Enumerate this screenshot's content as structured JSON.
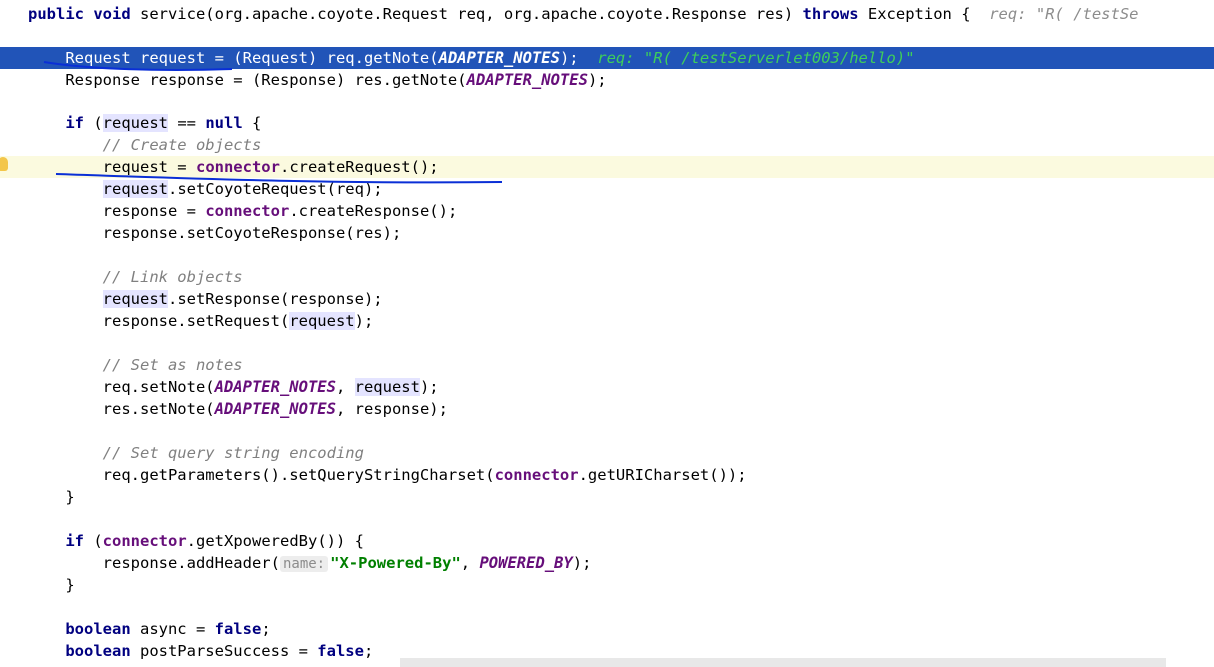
{
  "editor": {
    "lines": [
      {
        "id": "l0",
        "segs": [
          [
            "kw",
            "public void "
          ],
          [
            "",
            "service(org.apache.coyote.Request req, org.apache.coyote.Response res) "
          ],
          [
            "kw",
            "throws "
          ],
          [
            "",
            "Exception {  "
          ],
          [
            "inline-val",
            "req: \"R( /testSe"
          ]
        ]
      },
      {
        "id": "l1",
        "segs": []
      },
      {
        "id": "l2",
        "cls": "exec",
        "segs": [
          [
            "",
            "    Request request = (Request) req.getNote("
          ],
          [
            "const",
            "ADAPTER_NOTES"
          ],
          [
            "",
            ");  "
          ],
          [
            "inline-val",
            "req: \"R( /testServerlet003/hello)\""
          ]
        ]
      },
      {
        "id": "l3",
        "segs": [
          [
            "",
            "    Response response = (Response) res.getNote("
          ],
          [
            "const",
            "ADAPTER_NOTES"
          ],
          [
            "",
            ");"
          ]
        ]
      },
      {
        "id": "l4",
        "segs": []
      },
      {
        "id": "l5",
        "segs": [
          [
            "",
            "    "
          ],
          [
            "kw",
            "if "
          ],
          [
            "",
            "("
          ],
          [
            "hl",
            "request"
          ],
          [
            "",
            " == "
          ],
          [
            "kw",
            "null"
          ],
          [
            "",
            " {"
          ]
        ]
      },
      {
        "id": "l6",
        "segs": [
          [
            "",
            "        "
          ],
          [
            "cmt",
            "// Create objects"
          ]
        ]
      },
      {
        "id": "l7",
        "cls": "caret",
        "segs": [
          [
            "",
            "        request = "
          ],
          [
            "field",
            "connector"
          ],
          [
            "",
            ".createRequest();"
          ]
        ]
      },
      {
        "id": "l8",
        "segs": [
          [
            "",
            "        "
          ],
          [
            "hl",
            "request"
          ],
          [
            "",
            ".setCoyoteRequest(req);"
          ]
        ]
      },
      {
        "id": "l9",
        "segs": [
          [
            "",
            "        response = "
          ],
          [
            "field",
            "connector"
          ],
          [
            "",
            ".createResponse();"
          ]
        ]
      },
      {
        "id": "l10",
        "segs": [
          [
            "",
            "        response.setCoyoteResponse(res);"
          ]
        ]
      },
      {
        "id": "l11",
        "segs": []
      },
      {
        "id": "l12",
        "segs": [
          [
            "",
            "        "
          ],
          [
            "cmt",
            "// Link objects"
          ]
        ]
      },
      {
        "id": "l13",
        "segs": [
          [
            "",
            "        "
          ],
          [
            "hl",
            "request"
          ],
          [
            "",
            ".setResponse(response);"
          ]
        ]
      },
      {
        "id": "l14",
        "segs": [
          [
            "",
            "        response.setRequest("
          ],
          [
            "hl",
            "request"
          ],
          [
            "",
            ");"
          ]
        ]
      },
      {
        "id": "l15",
        "segs": []
      },
      {
        "id": "l16",
        "segs": [
          [
            "",
            "        "
          ],
          [
            "cmt",
            "// Set as notes"
          ]
        ]
      },
      {
        "id": "l17",
        "segs": [
          [
            "",
            "        req.setNote("
          ],
          [
            "const",
            "ADAPTER_NOTES"
          ],
          [
            "",
            ", "
          ],
          [
            "hl",
            "request"
          ],
          [
            "",
            ");"
          ]
        ]
      },
      {
        "id": "l18",
        "segs": [
          [
            "",
            "        res.setNote("
          ],
          [
            "const",
            "ADAPTER_NOTES"
          ],
          [
            "",
            ", response);"
          ]
        ]
      },
      {
        "id": "l19",
        "segs": []
      },
      {
        "id": "l20",
        "segs": [
          [
            "",
            "        "
          ],
          [
            "cmt",
            "// Set query string encoding"
          ]
        ]
      },
      {
        "id": "l21",
        "segs": [
          [
            "",
            "        req.getParameters().setQueryStringCharset("
          ],
          [
            "field",
            "connector"
          ],
          [
            "",
            ".getURICharset());"
          ]
        ]
      },
      {
        "id": "l22",
        "segs": [
          [
            "",
            "    }"
          ]
        ]
      },
      {
        "id": "l23",
        "segs": []
      },
      {
        "id": "l24",
        "segs": [
          [
            "",
            "    "
          ],
          [
            "kw",
            "if "
          ],
          [
            "",
            "("
          ],
          [
            "field",
            "connector"
          ],
          [
            "",
            ".getXpoweredBy()) {"
          ]
        ]
      },
      {
        "id": "l25",
        "segs": [
          [
            "",
            "        response.addHeader("
          ],
          [
            "hint",
            "name:"
          ],
          [
            "str",
            "\"X-Powered-By\""
          ],
          [
            "",
            ", "
          ],
          [
            "const",
            "POWERED_BY"
          ],
          [
            "",
            ");"
          ]
        ]
      },
      {
        "id": "l26",
        "segs": [
          [
            "",
            "    }"
          ]
        ]
      },
      {
        "id": "l27",
        "segs": []
      },
      {
        "id": "l28",
        "segs": [
          [
            "",
            "    "
          ],
          [
            "kw",
            "boolean "
          ],
          [
            "",
            "async = "
          ],
          [
            "kw",
            "false"
          ],
          [
            "",
            ";"
          ]
        ]
      },
      {
        "id": "l29",
        "segs": [
          [
            "",
            "    "
          ],
          [
            "kw",
            "boolean "
          ],
          [
            "",
            "postParseSuccess = "
          ],
          [
            "kw",
            "false"
          ],
          [
            "",
            ";"
          ]
        ]
      }
    ]
  },
  "colors": {
    "execution_line": "#2154b8",
    "caret_line": "#fbfadf",
    "annotation_ink": "#0a2fd6"
  },
  "icons": {
    "gutter": "lightbulb-icon"
  }
}
